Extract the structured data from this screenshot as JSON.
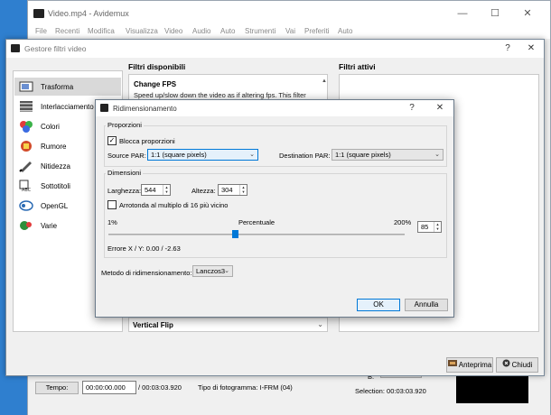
{
  "avidemux": {
    "title": "Video.mp4 - Avidemux",
    "window_controls": {
      "minimize": "—",
      "maximize": "☐",
      "close": "✕"
    },
    "menu": [
      "File",
      "Recenti",
      "Modifica",
      "Visualizza",
      "Video",
      "Audio",
      "Auto",
      "Strumenti",
      "Vai",
      "Preferiti",
      "Auto"
    ],
    "bottom": {
      "time_button": "Tempo:",
      "time_value": "00:00:00.000",
      "duration": "/ 00:03:03.920",
      "frame_type": "Tipo di fotogramma:  I-FRM (04)",
      "b_label": "B:",
      "selection": "Selection: 00:03:03.920"
    }
  },
  "filter_manager": {
    "title": "Gestore filtri video",
    "controls": {
      "help": "?",
      "close": "✕"
    },
    "categories": [
      {
        "label": "Trasforma",
        "icon": "transform-icon",
        "selected": true
      },
      {
        "label": "Interlacciamento",
        "icon": "interlace-icon",
        "selected": false
      },
      {
        "label": "Colori",
        "icon": "colors-icon",
        "selected": false
      },
      {
        "label": "Rumore",
        "icon": "noise-icon",
        "selected": false
      },
      {
        "label": "Nitidezza",
        "icon": "sharpness-icon",
        "selected": false
      },
      {
        "label": "Sottotitoli",
        "icon": "subtitles-icon",
        "selected": false
      },
      {
        "label": "OpenGL",
        "icon": "opengl-icon",
        "selected": false
      },
      {
        "label": "Varie",
        "icon": "misc-icon",
        "selected": false
      }
    ],
    "available_title": "Filtri disponibili",
    "active_title": "Filtri attivi",
    "available_first": {
      "title": "Change FPS",
      "desc": "Speed up/slow down the video as if altering fps. This filter"
    },
    "available_last": "Vertical Flip",
    "buttons": {
      "preview": "Anteprima",
      "close": "Chiudi"
    }
  },
  "resize": {
    "title": "Ridimensionamento",
    "controls": {
      "help": "?",
      "close": "✕"
    },
    "proportions": {
      "group_title": "Proporzioni",
      "lock_label": "Blocca proporzioni",
      "lock_checked": true,
      "source_par_label": "Source PAR:",
      "source_par_value": "1:1 (square pixels)",
      "dest_par_label": "Destination PAR:",
      "dest_par_value": "1:1 (square pixels)"
    },
    "dimensions": {
      "group_title": "Dimensioni",
      "width_label": "Larghezza:",
      "width_value": "544",
      "height_label": "Altezza:",
      "height_value": "304",
      "round_label": "Arrotonda al multiplo di 16 più vicino",
      "round_checked": false,
      "pct_min": "1%",
      "pct_label": "Percentuale",
      "pct_max": "200%",
      "pct_value": "85",
      "error_text": "Errore X / Y:  0.00 / -2.63"
    },
    "method_label": "Metodo di ridimensionamento:",
    "method_value": "Lanczos3",
    "ok": "OK",
    "cancel": "Annulla"
  }
}
